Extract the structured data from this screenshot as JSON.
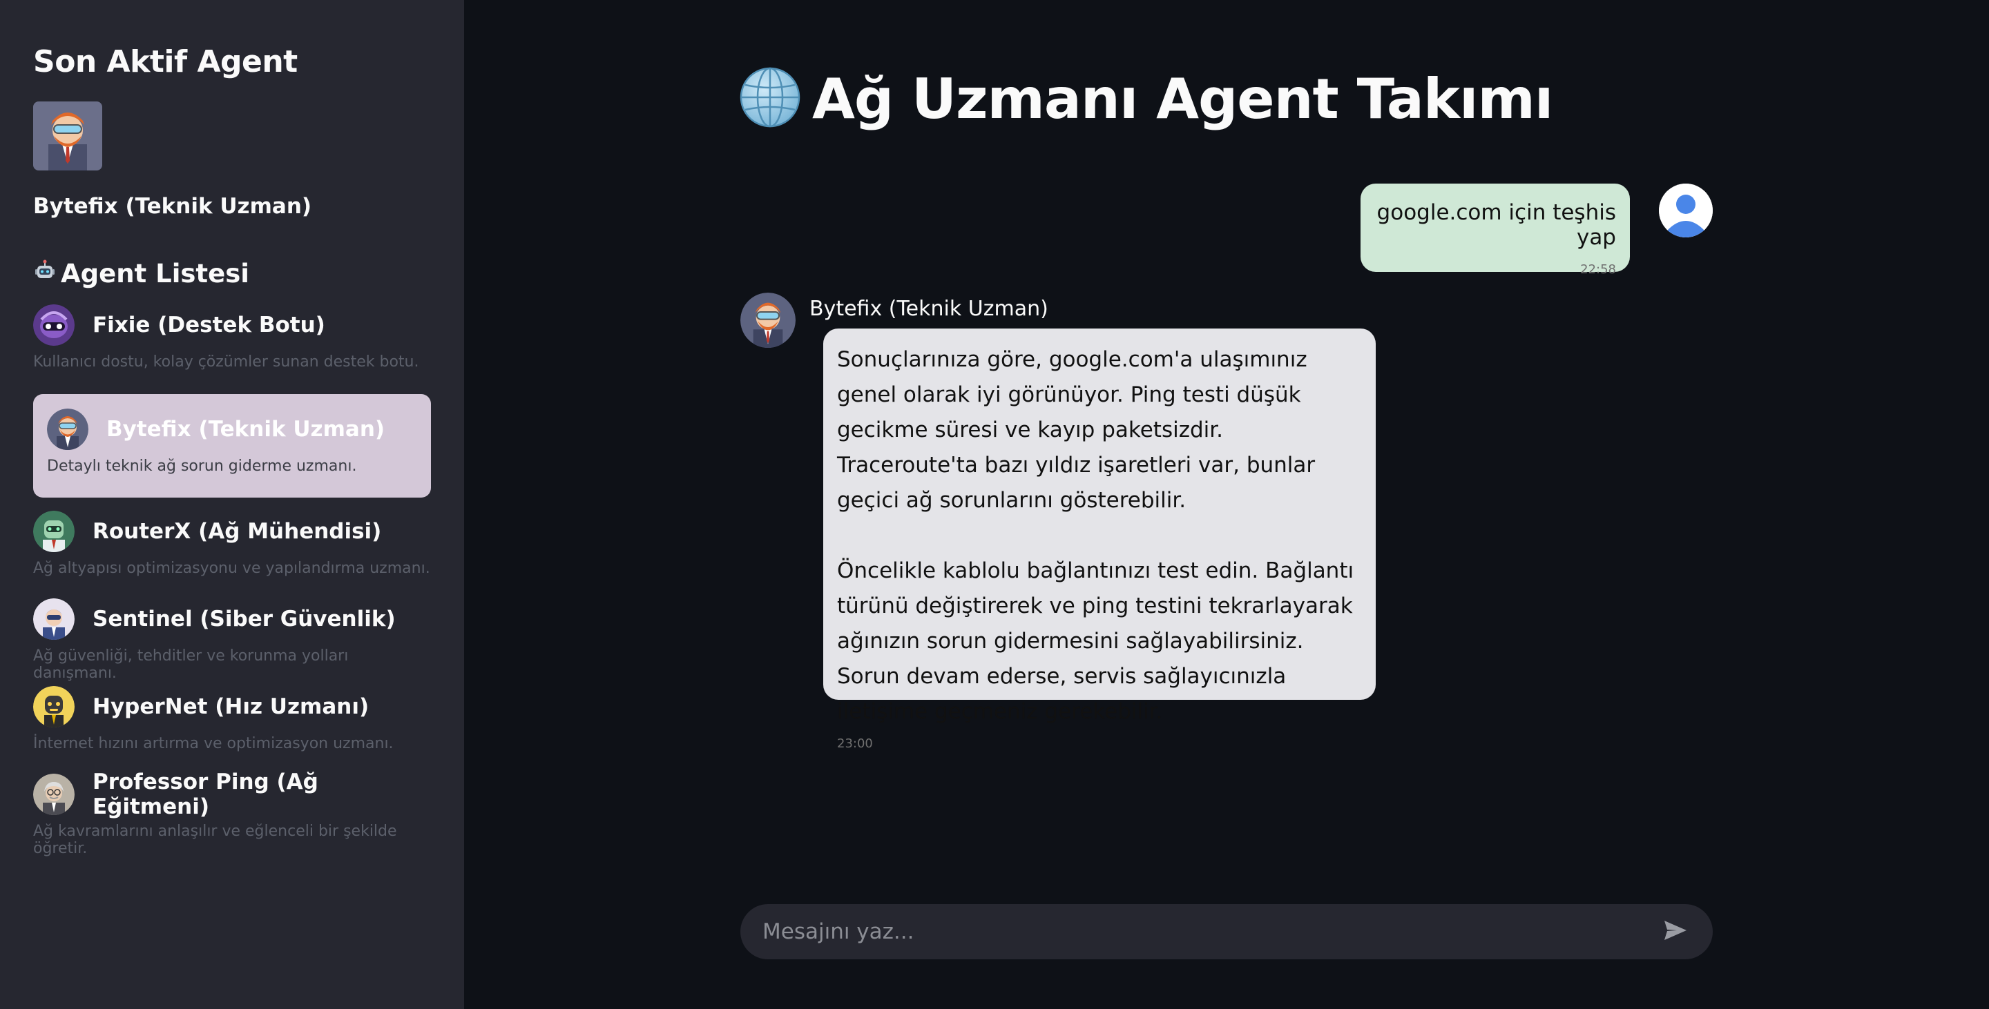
{
  "sidebar": {
    "active_heading": "Son Aktif Agent",
    "active_agent_name": "Bytefix (Teknik Uzman)",
    "list_title": "Agent Listesi",
    "agents": [
      {
        "name": "Fixie (Destek Botu)",
        "desc": "Kullanıcı dostu, kolay çözümler sunan destek botu.",
        "avatar": "purple-robot-avatar"
      },
      {
        "name": "Bytefix (Teknik Uzman)",
        "desc": "Detaylı teknik ağ sorun giderme uzmanı.",
        "avatar": "engineer-avatar",
        "selected": true
      },
      {
        "name": "RouterX (Ağ Mühendisi)",
        "desc": "Ağ altyapısı optimizasyonu ve yapılandırma uzmanı.",
        "avatar": "green-robot-avatar"
      },
      {
        "name": "Sentinel (Siber Güvenlik)",
        "desc": "Ağ güvenliği, tehditler ve korunma yolları danışmanı.",
        "avatar": "blue-agent-avatar"
      },
      {
        "name": "HyperNet (Hız Uzmanı)",
        "desc": "İnternet hızını artırma ve optimizasyon uzmanı.",
        "avatar": "yellow-robot-avatar"
      },
      {
        "name": "Professor Ping (Ağ Eğitmeni)",
        "desc": "Ağ kavramlarını anlaşılır ve eğlenceli bir şekilde öğretir.",
        "avatar": "professor-avatar"
      }
    ]
  },
  "main": {
    "title": "Ağ Uzmanı Agent Takımı",
    "title_icon": "globe-icon",
    "messages": {
      "user": {
        "text": "google.com için teşhis yap",
        "time": "22:58"
      },
      "bot": {
        "name": "Bytefix (Teknik Uzman)",
        "p1": "Sonuçlarınıza göre, google.com'a ulaşımınız genel olarak iyi görünüyor. Ping testi düşük gecikme süresi ve kayıp paketsizdir. Traceroute'ta bazı yıldız işaretleri var, bunlar geçici ağ sorunlarını gösterebilir.",
        "p2": "Öncelikle kablolu bağlantınızı test edin. Bağlantı türünü değiştirerek ve ping testini tekrarlayarak ağınızın sorun gidermesini sağlayabilirsiniz. Sorun devam ederse, servis sağlayıcınızla iletişime geçmeniz gerekebilir.",
        "time": "23:00"
      }
    },
    "input": {
      "placeholder": "Mesajını yaz..."
    }
  },
  "colors": {
    "background": "#0e1117",
    "sidebar": "#262730",
    "selected_agent": "#d4c8d8",
    "user_bubble": "#cfe8d6",
    "bot_bubble": "#e4e4e8"
  }
}
